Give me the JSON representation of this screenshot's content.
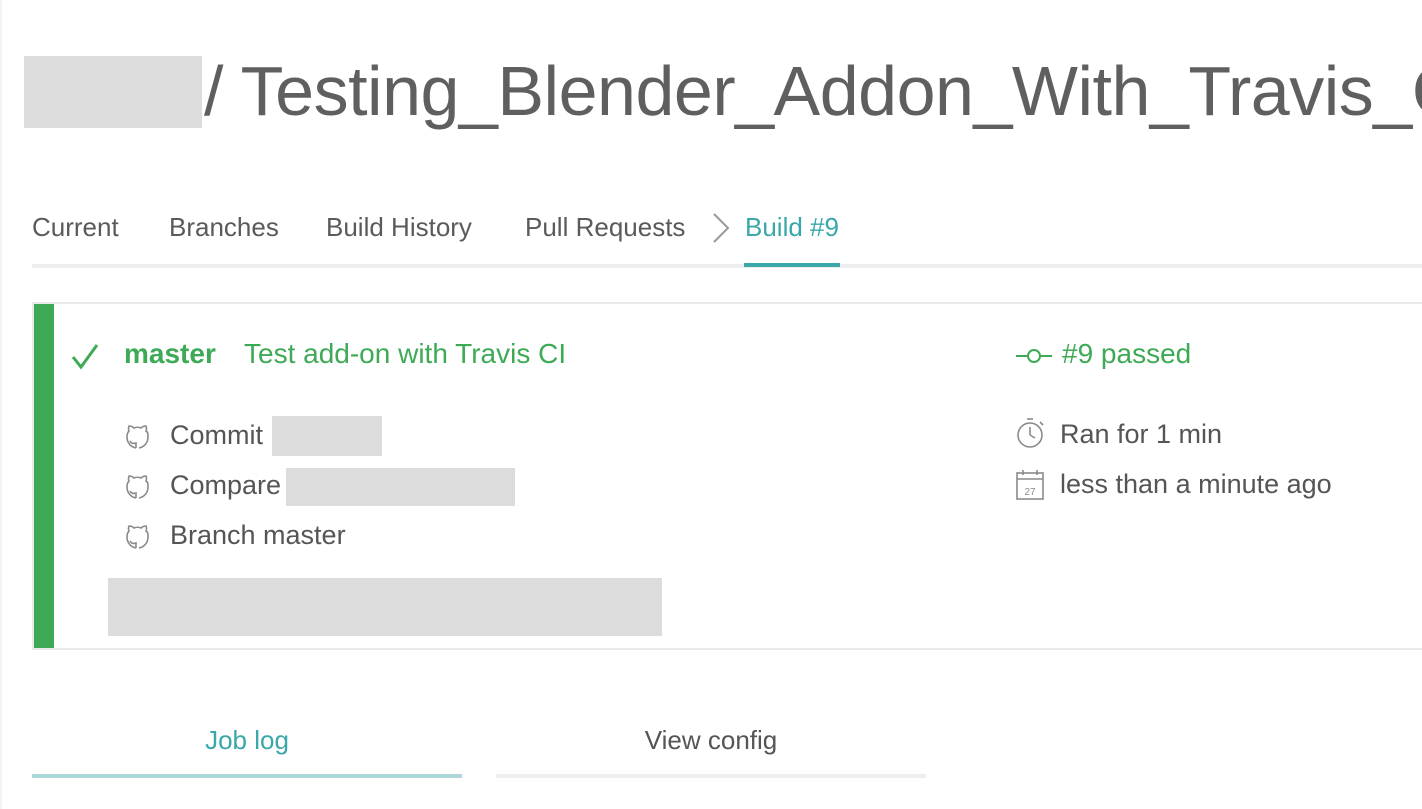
{
  "header": {
    "repo_name": "/ Testing_Blender_Addon_With_Travis_CI"
  },
  "tabs": {
    "current": "Current",
    "branches": "Branches",
    "build_history": "Build History",
    "pull_requests": "Pull Requests",
    "build": "Build #9"
  },
  "build": {
    "branch": "master",
    "message": "Test add-on with Travis CI",
    "status": "#9 passed",
    "commit_label": "Commit",
    "compare_label": "Compare",
    "branch_label": "Branch master",
    "duration": "Ran for 1 min",
    "finished": "less than a minute ago",
    "calendar_day": "27",
    "status_color": "#3eaa56"
  },
  "log_tabs": {
    "job_log": "Job log",
    "view_config": "View config"
  },
  "colors": {
    "accent": "#3aa7a9",
    "passed": "#3eaa56",
    "redacted": "#dcdcdc"
  },
  "icons": [
    "check-icon",
    "github-icon",
    "commit-node-icon",
    "stopwatch-icon",
    "calendar-icon",
    "chevron-right-icon"
  ]
}
